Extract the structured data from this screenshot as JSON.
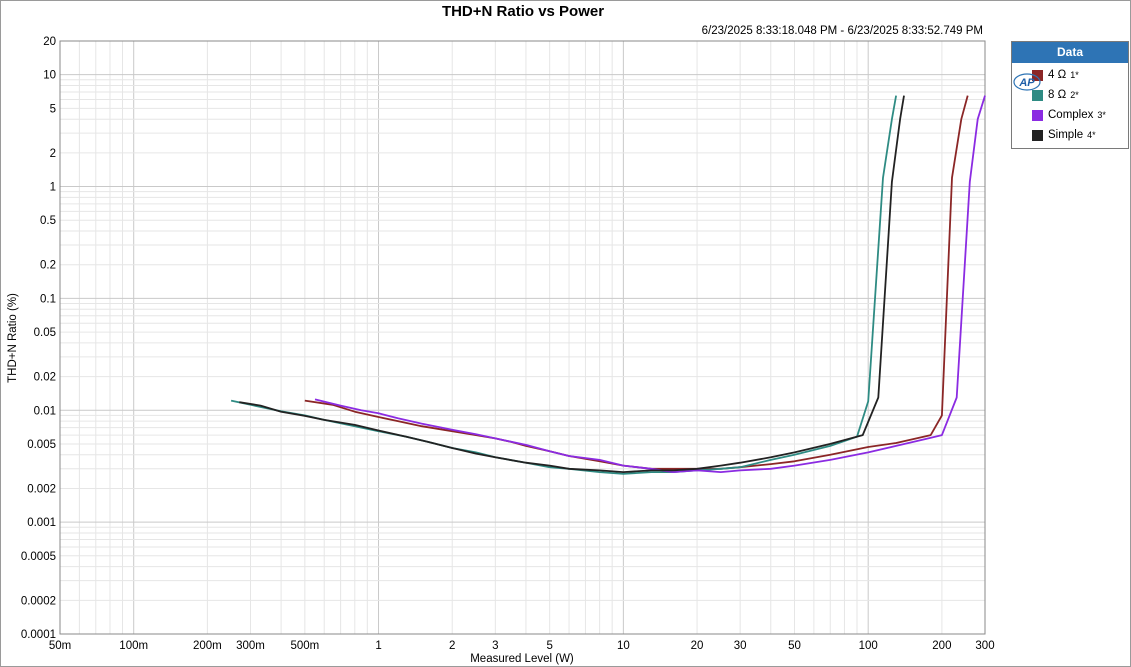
{
  "chart_data": {
    "type": "line",
    "title": "THD+N Ratio vs Power",
    "subtitle": "6/23/2025 8:33:18.048 PM - 6/23/2025 8:33:52.749 PM",
    "xlabel": "Measured Level (W)",
    "ylabel": "THD+N Ratio (%)",
    "xscale": "log",
    "yscale": "log",
    "xlim": [
      0.05,
      300
    ],
    "ylim": [
      0.0001,
      20
    ],
    "grid": true,
    "legend_position": "right",
    "x_ticks": [
      {
        "v": 0.05,
        "label": "50m"
      },
      {
        "v": 0.1,
        "label": "100m"
      },
      {
        "v": 0.2,
        "label": "200m"
      },
      {
        "v": 0.3,
        "label": "300m"
      },
      {
        "v": 0.5,
        "label": "500m"
      },
      {
        "v": 1,
        "label": "1"
      },
      {
        "v": 2,
        "label": "2"
      },
      {
        "v": 3,
        "label": "3"
      },
      {
        "v": 5,
        "label": "5"
      },
      {
        "v": 10,
        "label": "10"
      },
      {
        "v": 20,
        "label": "20"
      },
      {
        "v": 30,
        "label": "30"
      },
      {
        "v": 50,
        "label": "50"
      },
      {
        "v": 100,
        "label": "100"
      },
      {
        "v": 200,
        "label": "200"
      },
      {
        "v": 300,
        "label": "300"
      }
    ],
    "y_ticks": [
      {
        "v": 20,
        "label": "20"
      },
      {
        "v": 10,
        "label": "10"
      },
      {
        "v": 5,
        "label": "5"
      },
      {
        "v": 2,
        "label": "2"
      },
      {
        "v": 1,
        "label": "1"
      },
      {
        "v": 0.5,
        "label": "0.5"
      },
      {
        "v": 0.2,
        "label": "0.2"
      },
      {
        "v": 0.1,
        "label": "0.1"
      },
      {
        "v": 0.05,
        "label": "0.05"
      },
      {
        "v": 0.02,
        "label": "0.02"
      },
      {
        "v": 0.01,
        "label": "0.01"
      },
      {
        "v": 0.005,
        "label": "0.005"
      },
      {
        "v": 0.002,
        "label": "0.002"
      },
      {
        "v": 0.001,
        "label": "0.001"
      },
      {
        "v": 0.0005,
        "label": "0.0005"
      },
      {
        "v": 0.0002,
        "label": "0.0002"
      },
      {
        "v": 0.0001,
        "label": "0.0001"
      }
    ],
    "series": [
      {
        "name": "4 Ω",
        "index": "1*",
        "color": "#8b2626",
        "x": [
          0.5,
          0.65,
          0.8,
          1.0,
          1.2,
          1.5,
          2.0,
          2.5,
          3.0,
          3.5,
          4.0,
          5.0,
          6.0,
          8.0,
          10,
          13,
          16,
          20,
          25,
          30,
          40,
          50,
          70,
          100,
          130,
          180,
          200,
          220,
          240,
          255
        ],
        "y": [
          0.0122,
          0.0112,
          0.0097,
          0.0087,
          0.008,
          0.0072,
          0.0065,
          0.006,
          0.0056,
          0.0052,
          0.0048,
          0.0043,
          0.0039,
          0.0035,
          0.0032,
          0.003,
          0.003,
          0.003,
          0.003,
          0.0031,
          0.0033,
          0.0035,
          0.004,
          0.0047,
          0.0051,
          0.006,
          0.009,
          1.2,
          4.0,
          6.5
        ]
      },
      {
        "name": "8 Ω",
        "index": "2*",
        "color": "#2e8b83",
        "x": [
          0.25,
          0.3,
          0.4,
          0.5,
          0.6,
          0.8,
          1.0,
          1.3,
          1.6,
          2.0,
          2.5,
          3.0,
          4.0,
          5.0,
          6.0,
          8.0,
          10,
          13,
          16,
          20,
          25,
          30,
          40,
          50,
          70,
          90,
          100,
          115,
          125,
          130
        ],
        "y": [
          0.0122,
          0.0112,
          0.0098,
          0.009,
          0.0082,
          0.0072,
          0.0065,
          0.0058,
          0.0052,
          0.0046,
          0.0042,
          0.0038,
          0.0034,
          0.0031,
          0.003,
          0.0028,
          0.0027,
          0.0028,
          0.0028,
          0.0029,
          0.003,
          0.0031,
          0.0036,
          0.004,
          0.0048,
          0.0058,
          0.012,
          1.2,
          4.0,
          6.5
        ]
      },
      {
        "name": "Complex",
        "index": "3*",
        "color": "#8b2be2",
        "x": [
          0.55,
          0.7,
          0.85,
          1.0,
          1.2,
          1.5,
          2.0,
          2.5,
          3.0,
          4.0,
          5.0,
          6.0,
          8.0,
          10,
          13,
          16,
          20,
          25,
          30,
          40,
          50,
          70,
          100,
          130,
          170,
          200,
          230,
          260,
          280,
          300
        ],
        "y": [
          0.0125,
          0.011,
          0.01,
          0.0094,
          0.0085,
          0.0076,
          0.0067,
          0.0061,
          0.0056,
          0.0049,
          0.0043,
          0.0039,
          0.0036,
          0.0032,
          0.003,
          0.0028,
          0.0029,
          0.0028,
          0.0029,
          0.003,
          0.0032,
          0.0036,
          0.0042,
          0.0048,
          0.0055,
          0.006,
          0.013,
          1.1,
          4.0,
          6.5
        ]
      },
      {
        "name": "Simple",
        "index": "4*",
        "color": "#222222",
        "x": [
          0.27,
          0.33,
          0.4,
          0.5,
          0.6,
          0.8,
          1.0,
          1.3,
          1.6,
          2.0,
          2.5,
          3.0,
          4.0,
          5.0,
          6.0,
          8.0,
          10,
          13,
          16,
          20,
          25,
          30,
          40,
          50,
          70,
          95,
          110,
          125,
          135,
          140
        ],
        "y": [
          0.0118,
          0.011,
          0.0097,
          0.0089,
          0.0082,
          0.0074,
          0.0066,
          0.0058,
          0.0052,
          0.0046,
          0.0041,
          0.0038,
          0.0034,
          0.0032,
          0.003,
          0.0029,
          0.0028,
          0.0029,
          0.0029,
          0.003,
          0.0032,
          0.0034,
          0.0038,
          0.0042,
          0.005,
          0.006,
          0.013,
          1.1,
          4.0,
          6.5
        ]
      }
    ]
  },
  "legend": {
    "title": "Data",
    "logo_text": "AP",
    "items": [
      {
        "label": "4 Ω",
        "index": "1*",
        "color": "#8b2626"
      },
      {
        "label": "8 Ω",
        "index": "2*",
        "color": "#2e8b83"
      },
      {
        "label": "Complex",
        "index": "3*",
        "color": "#8b2be2"
      },
      {
        "label": "Simple",
        "index": "4*",
        "color": "#222222"
      }
    ]
  }
}
